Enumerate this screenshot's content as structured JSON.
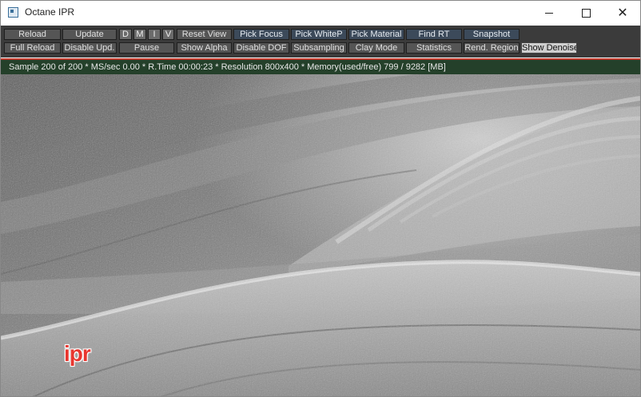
{
  "window": {
    "title": "Octane IPR",
    "controls": {
      "minimize": "—",
      "maximize": "☐",
      "close": "✕"
    }
  },
  "toolbar": {
    "reload": "Reload",
    "full_reload": "Full Reload",
    "update": "Update",
    "disable_upd": "Disable Upd.",
    "mode_d": "D",
    "mode_m": "M",
    "mode_i": "I",
    "mode_v": "V",
    "pause": "Pause",
    "reset_view": "Reset View",
    "show_alpha": "Show Alpha",
    "pick_focus": "Pick Focus",
    "disable_dof": "Disable DOF",
    "pick_whitep": "Pick WhiteP",
    "subsampling": "Subsampling",
    "pick_material": "Pick Material",
    "clay_mode": "Clay Mode",
    "find_rt": "Find RT",
    "statistics": "Statistics",
    "snapshot": "Snapshot",
    "rend_region": "Rend. Region",
    "show_denoise": "Show Denoise"
  },
  "status": {
    "text": "Sample 200 of 200 * MS/sec 0.00 * R.Time 00:00:23 * Resolution 800x400 * Memory(used/free) 799 / 9282 [MB]"
  },
  "render": {
    "overlay_label": "ipr"
  },
  "colors": {
    "toolbar_bg": "#3b3b3b",
    "status_bg": "#24402a",
    "status_border": "#c0392b",
    "overlay_label": "#e8362f"
  }
}
